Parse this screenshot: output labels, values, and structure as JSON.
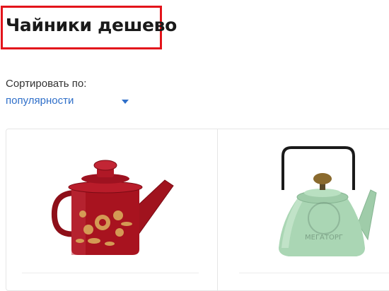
{
  "header": {
    "title": "Чайники дешево"
  },
  "sort": {
    "label": "Сортировать по:",
    "selected": "популярности"
  },
  "products": [
    {
      "image": "red-enamel-kettle",
      "color": "#a0131e",
      "pattern": "gold-floral"
    },
    {
      "image": "mint-green-enamel-kettle",
      "color": "#a8d4b2",
      "watermark": "МЕГАТОРГ"
    }
  ],
  "colors": {
    "accent": "#2f6fc9",
    "highlight": "#e3141b"
  }
}
